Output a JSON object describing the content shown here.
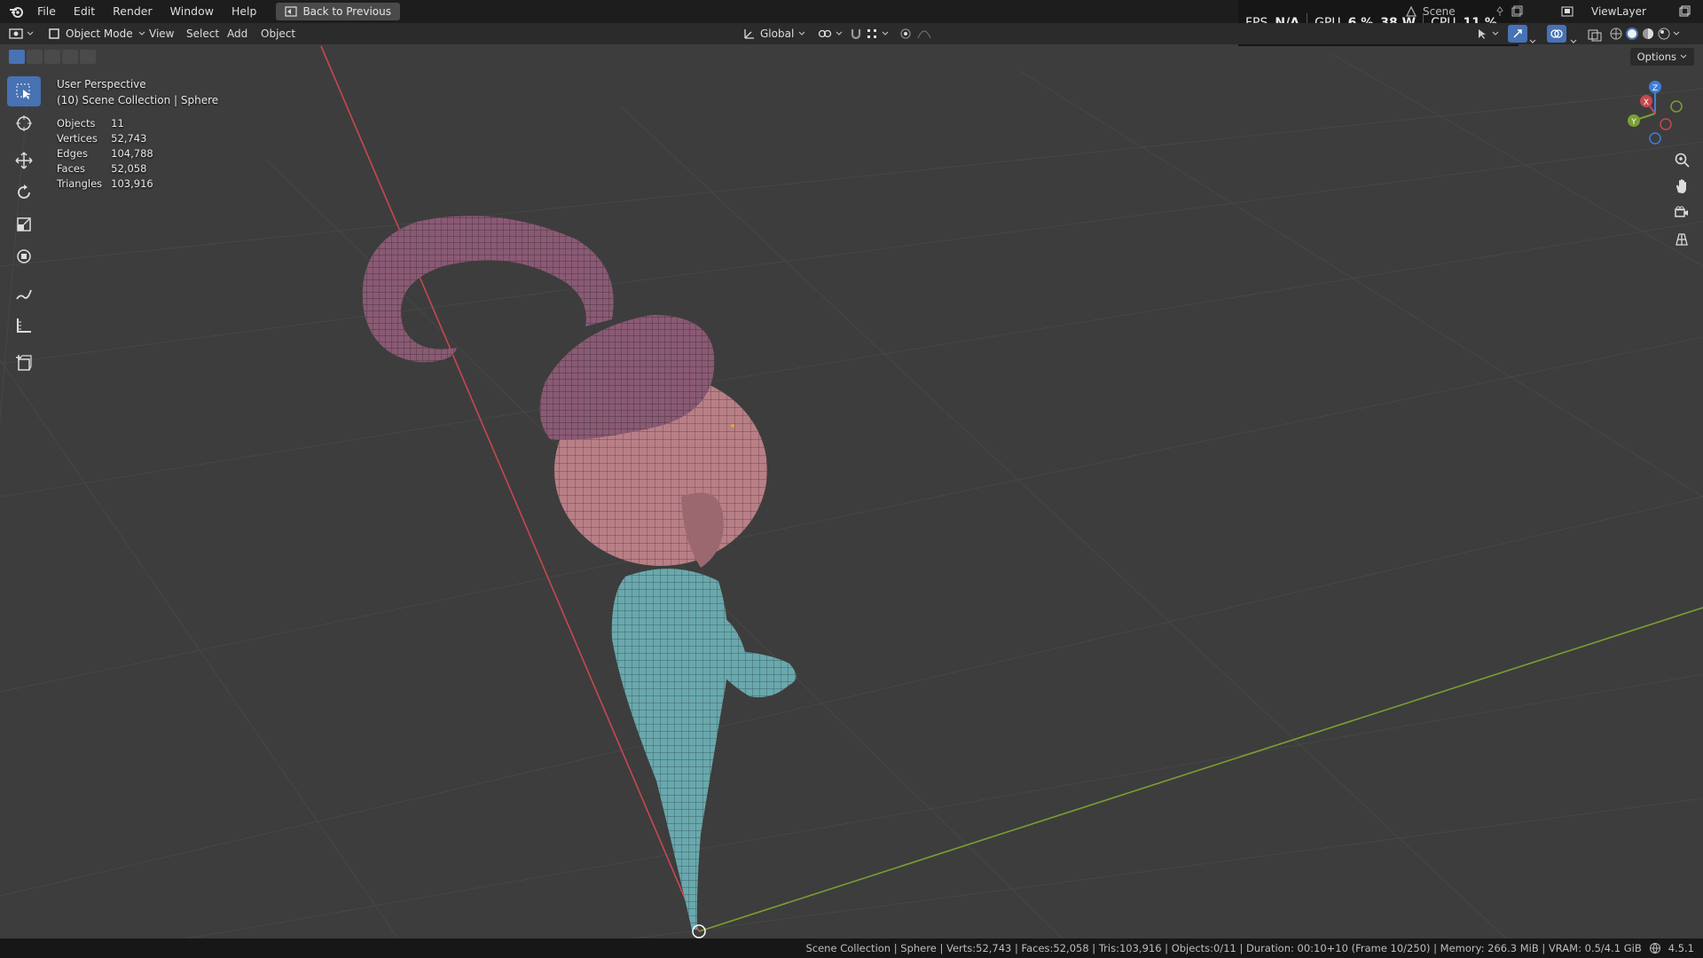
{
  "topbar": {
    "menus": [
      "File",
      "Edit",
      "Render",
      "Window",
      "Help"
    ],
    "back_label": "Back to Previous"
  },
  "hud": {
    "fps_label": "FPS",
    "fps_value": "N/A",
    "gpu_label": "GPU",
    "gpu_percent": "6 %",
    "gpu_watts": "38 W",
    "cpu_label": "CPU",
    "cpu_percent": "11 %"
  },
  "scene": {
    "name": "Scene",
    "view_layer": "ViewLayer"
  },
  "header": {
    "mode": "Object Mode",
    "menus": [
      "View",
      "Select",
      "Add",
      "Object"
    ],
    "transform_orientation": "Global",
    "options_label": "Options"
  },
  "viewport": {
    "perspective": "User Perspective",
    "collection_info": "(10) Scene Collection | Sphere",
    "stats": [
      {
        "label": "Objects",
        "value": "11"
      },
      {
        "label": "Vertices",
        "value": "52,743"
      },
      {
        "label": "Edges",
        "value": "104,788"
      },
      {
        "label": "Faces",
        "value": "52,058"
      },
      {
        "label": "Triangles",
        "value": "103,916"
      }
    ]
  },
  "gizmo": {
    "axes": [
      "Z",
      "Y",
      "X"
    ]
  },
  "statusbar": {
    "text": "Scene Collection | Sphere | Verts:52,743 | Faces:52,058 | Tris:103,916 | Objects:0/11 | Duration: 00:10+10 (Frame 10/250) | Memory: 266.3 MiB | VRAM: 0.5/4.1 GiB",
    "version": "4.5.1"
  },
  "colors": {
    "accent": "#4772b3",
    "x_axis": "#c8474f",
    "y_axis": "#7aa033",
    "z_axis": "#3d7fd9",
    "hair": "#8a5a74",
    "head": "#b87f86",
    "body": "#6aa8ad"
  }
}
